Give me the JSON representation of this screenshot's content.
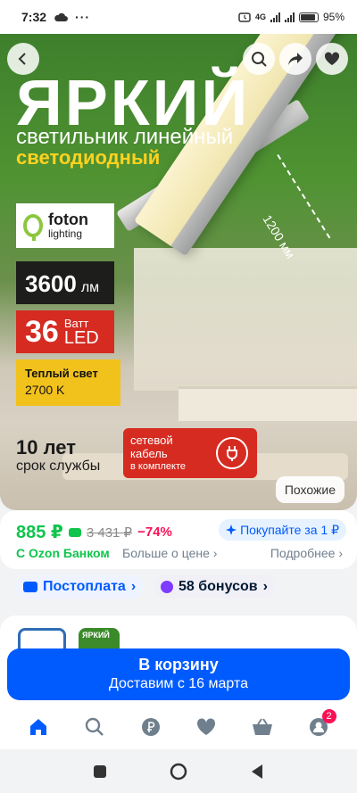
{
  "status_bar": {
    "time": "7:32",
    "network": "4G",
    "battery": "95%"
  },
  "hero": {
    "title": "ЯРКИЙ",
    "subtitle_line1": "светильник линейный",
    "subtitle_line2": "светодиодный",
    "dimension": "1200 мм",
    "brand_name": "foton",
    "brand_sub": "lighting",
    "lumens_value": "3600",
    "lumens_unit": "лм",
    "watt_value": "36",
    "watt_unit": "Ватт",
    "watt_type": "LED",
    "warm_title": "Теплый свет",
    "warm_value": "2700 K",
    "years_value": "10 лет",
    "years_label": "срок службы",
    "cable_line1": "сетевой",
    "cable_line2": "кабель",
    "cable_line3": "в комплекте",
    "similar_label": "Похожие"
  },
  "price": {
    "current": "885 ₽",
    "old": "3 431 ₽",
    "discount": "−74%",
    "buy_for": "Покупайте за 1 ₽",
    "bank_label": "С Ozon Банком",
    "more_about_price": "Больше о цене",
    "details": "Подробнее"
  },
  "chips": {
    "postpay": "Постоплата",
    "bonus": "58 бонусов"
  },
  "seller": {
    "thumb2_label": "ЯРКИЙ"
  },
  "cart": {
    "title": "В корзину",
    "delivery": "Доставим с 16 марта"
  },
  "tabbar": {
    "items": [
      "home-icon",
      "search-icon",
      "ruble-icon",
      "heart-icon",
      "basket-icon",
      "profile-icon"
    ],
    "profile_badge": "2"
  },
  "colors": {
    "accent": "#005bff",
    "price_green": "#10c44c",
    "discount_pink": "#f91155"
  }
}
